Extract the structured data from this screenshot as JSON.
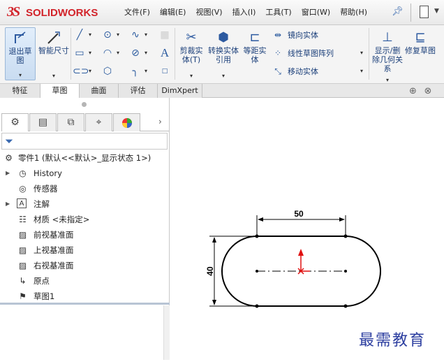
{
  "app": {
    "logo_ds": "3S",
    "logo_text": "SOLIDWORKS",
    "brand_color": "#d2232a"
  },
  "menu": [
    "文件(F)",
    "编辑(E)",
    "视图(V)",
    "插入(I)",
    "工具(T)",
    "窗口(W)",
    "帮助(H)"
  ],
  "ribbon": {
    "exit_sketch": "退出草图",
    "smart_dimension": "智能尺寸",
    "trim_entities": "剪裁实体(T)",
    "convert_entities": "转换实体引用",
    "offset_entities": "等距实体",
    "mirror_entities": "镜向实体",
    "linear_pattern": "线性草图阵列",
    "move_entities": "移动实体",
    "display_relations": "显示/删除几何关系",
    "repair_sketch": "修复草图"
  },
  "command_tabs": [
    "特征",
    "草图",
    "曲面",
    "评估",
    "DimXpert"
  ],
  "active_command_tab": "草图",
  "tree": {
    "root": "零件1  (默认<<默认>_显示状态 1>)",
    "items": [
      {
        "label": "History",
        "icon": "history-icon",
        "expandable": true
      },
      {
        "label": "传感器",
        "icon": "sensor-icon",
        "expandable": false
      },
      {
        "label": "注解",
        "icon": "annotation-icon",
        "expandable": true
      },
      {
        "label": "材质 <未指定>",
        "icon": "material-icon",
        "expandable": false
      },
      {
        "label": "前视基准面",
        "icon": "plane-icon",
        "expandable": false
      },
      {
        "label": "上视基准面",
        "icon": "plane-icon",
        "expandable": false
      },
      {
        "label": "右视基准面",
        "icon": "plane-icon",
        "expandable": false
      },
      {
        "label": "原点",
        "icon": "origin-icon",
        "expandable": false
      },
      {
        "label": "草图1",
        "icon": "sketch-icon",
        "expandable": false
      }
    ]
  },
  "sketch": {
    "dimension_width": "50",
    "dimension_height": "40",
    "origin_color": "#e01010"
  },
  "watermark": "最需教育"
}
